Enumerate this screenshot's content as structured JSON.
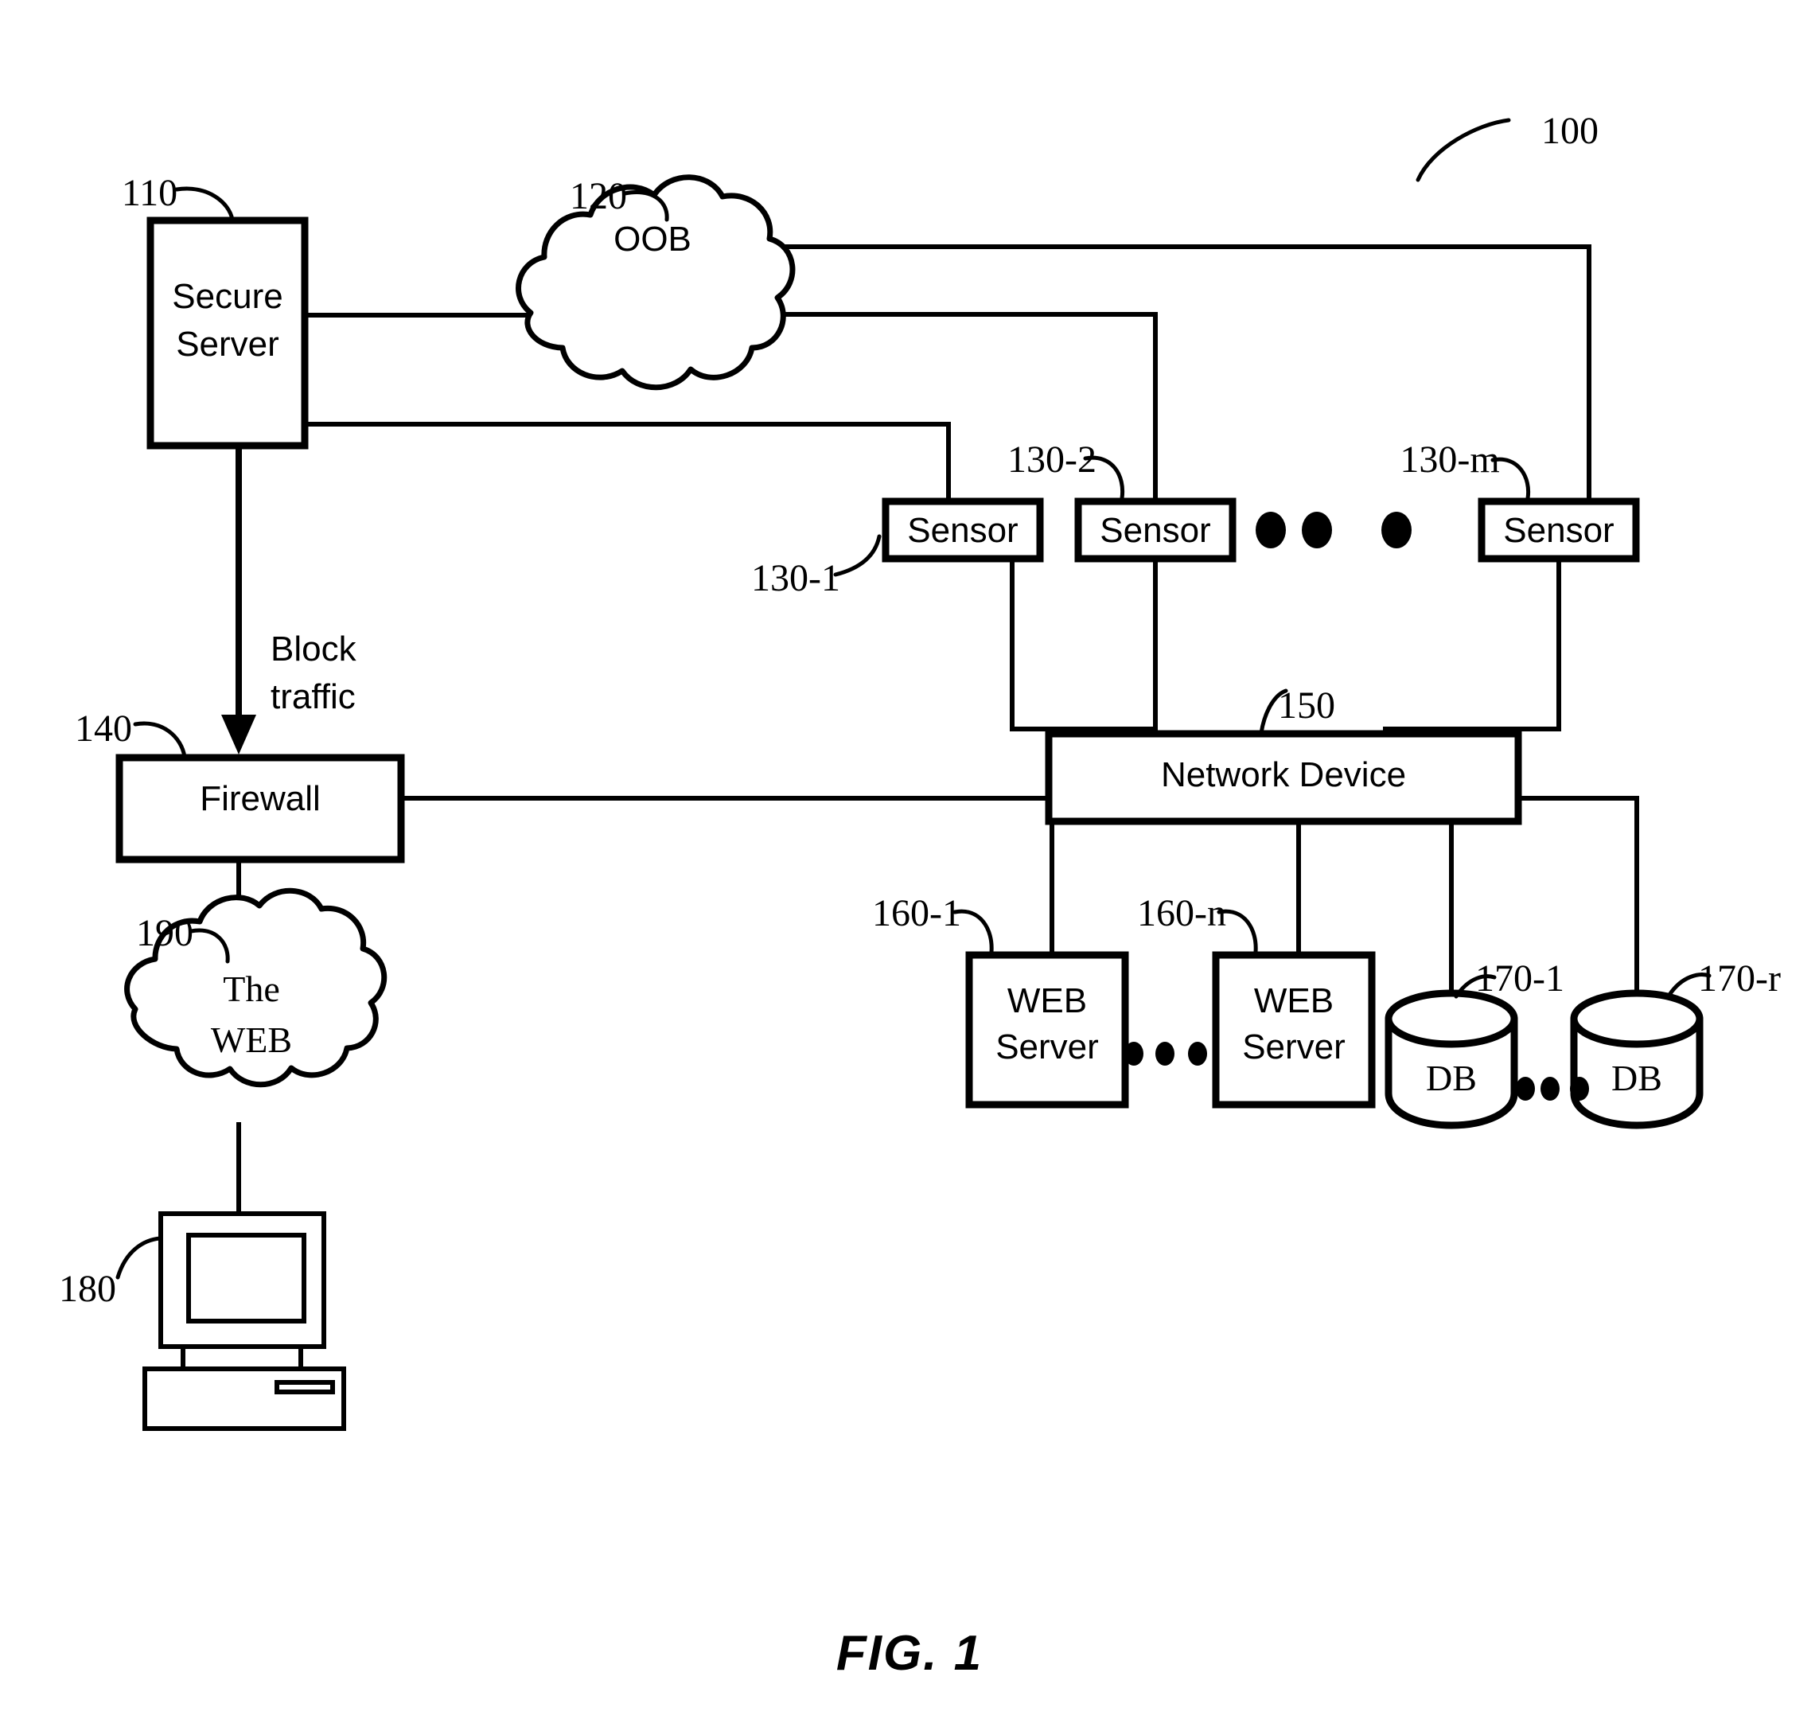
{
  "figure": {
    "caption": "FIG. 1",
    "system_ref": "100"
  },
  "nodes": {
    "secure_server": {
      "label_line1": "Secure",
      "label_line2": "Server",
      "ref": "110"
    },
    "oob_cloud": {
      "label": "OOB",
      "ref": "120"
    },
    "sensors": [
      {
        "label": "Sensor",
        "ref": "130-1"
      },
      {
        "label": "Sensor",
        "ref": "130-2"
      },
      {
        "label": "Sensor",
        "ref": "130-m"
      }
    ],
    "firewall": {
      "label": "Firewall",
      "ref": "140"
    },
    "network_device": {
      "label": "Network Device",
      "ref": "150"
    },
    "web_servers": [
      {
        "label_line1": "WEB",
        "label_line2": "Server",
        "ref": "160-1"
      },
      {
        "label_line1": "WEB",
        "label_line2": "Server",
        "ref": "160-n"
      }
    ],
    "databases": [
      {
        "label": "DB",
        "ref": "170-1"
      },
      {
        "label": "DB",
        "ref": "170-r"
      }
    ],
    "workstation": {
      "ref": "180"
    },
    "web_cloud": {
      "label_line1": "The",
      "label_line2": "WEB",
      "ref": "190"
    }
  },
  "annotations": {
    "block_traffic_line1": "Block",
    "block_traffic_line2": "traffic"
  },
  "colors": {
    "ink": "#000000",
    "paper": "#ffffff"
  }
}
